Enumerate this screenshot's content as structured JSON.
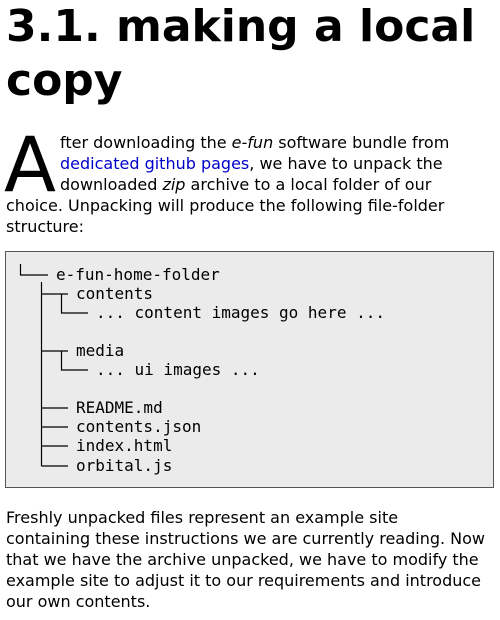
{
  "heading": "3.1. making a local copy",
  "intro": {
    "dropcap": "A",
    "text_1": "fter downloading the ",
    "emph_1": "e-fun",
    "text_2": " software bundle from ",
    "link": "dedicated github pages",
    "text_3": ", we have to unpack the downloaded ",
    "emph_2": "zip",
    "text_4": " archive to a local folder of our choice. Unpacking will produce the following file-folder structure:"
  },
  "tree": {
    "root": "e-fun-home-folder",
    "contents_folder": "contents",
    "contents_note": "... content images go here ...",
    "media_folder": "media",
    "media_note": "... ui images ...",
    "files": [
      "README.md",
      "contents.json",
      "index.html",
      "orbital.js"
    ]
  },
  "outro": "Freshly unpacked files represent an example site containing these instructions we are currently reading. Now that we have the archive unpacked, we have to modify the example site to adjust it to our requirements and introduce our own contents.",
  "colors": {
    "link": "#0000cc",
    "tree_background": "#ebebeb",
    "tree_border": "#555555"
  }
}
